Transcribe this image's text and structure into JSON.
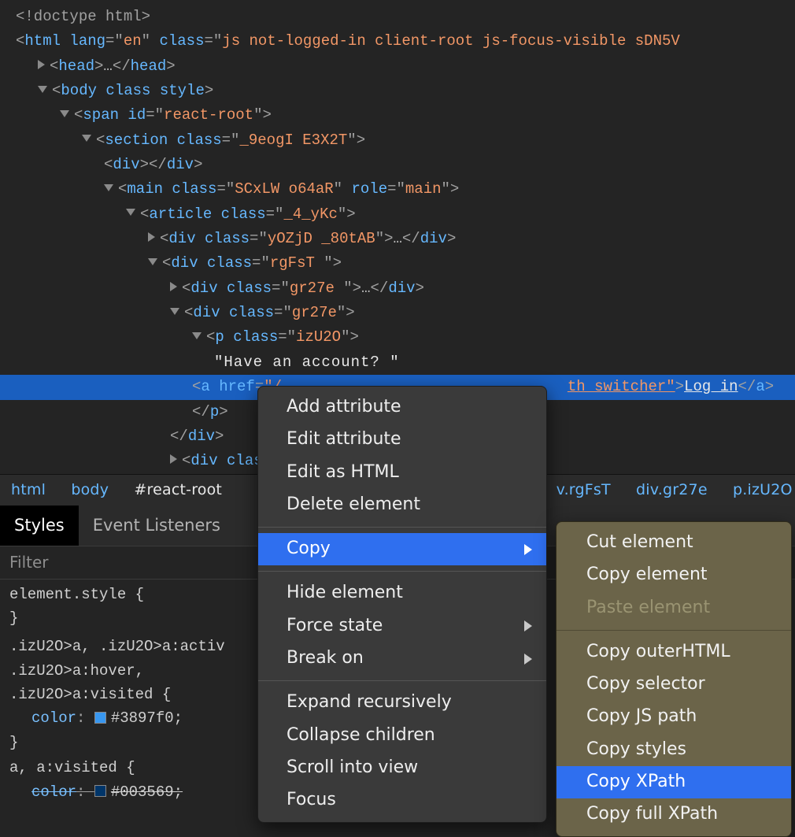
{
  "dom": {
    "doctype": "<!doctype html>",
    "html_lang": "en",
    "html_class": "js not-logged-in client-root js-focus-visible sDN5V",
    "head_open": "head",
    "head_ell": "…",
    "head_close": "head",
    "body_tag": "body",
    "body_attr1": "class",
    "body_attr2": "style",
    "span_tag": "span",
    "span_id_attr": "id",
    "span_id_val": "react-root",
    "section_tag": "section",
    "section_class": "_9eogI E3X2T",
    "div_tag": "div",
    "main_tag": "main",
    "main_class": "SCxLW  o64aR",
    "main_role_attr": "role",
    "main_role_val": "main",
    "article_tag": "article",
    "article_class": "_4_yKc",
    "div1_class": "yOZjD _80tAB",
    "div2_class": "rgFsT ",
    "div3_class": "gr27e ",
    "div4_class": "gr27e",
    "p_tag": "p",
    "p_class": "izU2O",
    "text_node": "\"Have an account? \"",
    "a_tag": "a",
    "a_href_attr": "href",
    "a_href_vis1": "\"/",
    "a_href_vis2": "th_switcher\"",
    "a_text": "Log in",
    "close_p": "p",
    "close_div": "div",
    "last_div_class_attr": "class"
  },
  "breadcrumb": {
    "b1": "html",
    "b2": "body",
    "b3": "#react-root",
    "b4": "v.rgFsT",
    "b5": "div.gr27e",
    "b6": "p.izU2O"
  },
  "tabs": {
    "styles": "Styles",
    "listeners": "Event Listeners"
  },
  "filter_placeholder": "Filter",
  "styles_pane": {
    "rule0_sel": "element.style {",
    "rule0_close": "}",
    "rule1_sel1": ".izU2O>a, .izU2O>a:activ",
    "rule1_sel2": ".izU2O>a:hover,",
    "rule1_sel3": ".izU2O>a:visited {",
    "rule1_prop": "color",
    "rule1_val": "#3897f0;",
    "rule1_swatch": "#3897f0",
    "rule1_close": "}",
    "rule2_sel": "a, a:visited {",
    "rule2_prop": "color",
    "rule2_val": "#003569;",
    "rule2_swatch": "#003569"
  },
  "menu1": {
    "add_attr": "Add attribute",
    "edit_attr": "Edit attribute",
    "edit_html": "Edit as HTML",
    "delete_el": "Delete element",
    "copy": "Copy",
    "hide": "Hide element",
    "force_state": "Force state",
    "break_on": "Break on",
    "expand": "Expand recursively",
    "collapse": "Collapse children",
    "scroll": "Scroll into view",
    "focus": "Focus"
  },
  "menu2": {
    "cut": "Cut element",
    "copy_el": "Copy element",
    "paste": "Paste element",
    "outer": "Copy outerHTML",
    "selector": "Copy selector",
    "jspath": "Copy JS path",
    "styles": "Copy styles",
    "xpath": "Copy XPath",
    "fullxpath": "Copy full XPath"
  }
}
